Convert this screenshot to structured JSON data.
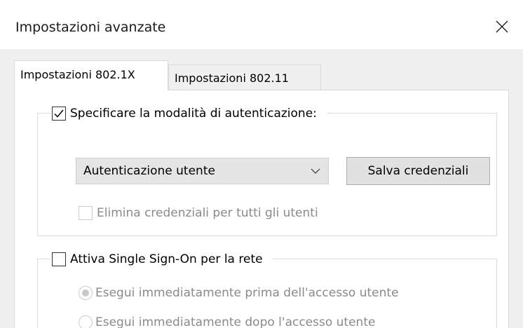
{
  "window": {
    "title": "Impostazioni avanzate",
    "close_icon": "close-icon"
  },
  "tabs": [
    {
      "label": "Impostazioni 802.1X",
      "active": true
    },
    {
      "label": "Impostazioni 802.11",
      "active": false
    }
  ],
  "auth_group": {
    "checkbox_label": "Specificare la modalità di autenticazione:",
    "checkbox_checked": true,
    "mode_select_value": "Autenticazione utente",
    "save_credentials_label": "Salva credenziali",
    "delete_credentials_label": "Elimina credenziali per tutti gli utenti",
    "delete_credentials_checked": false,
    "delete_credentials_enabled": false
  },
  "sso_group": {
    "checkbox_label": "Attiva Single Sign-On per la rete",
    "checkbox_checked": false,
    "options": [
      {
        "label": "Esegui immediatamente prima dell'accesso utente",
        "selected": true,
        "enabled": false
      },
      {
        "label": "Esegui immediatamente dopo l'accesso utente",
        "selected": false,
        "enabled": false
      }
    ]
  },
  "colors": {
    "disabled_text": "#8a8a8a",
    "client_bg": "#f0f0f0",
    "panel_bg": "#ffffff"
  }
}
